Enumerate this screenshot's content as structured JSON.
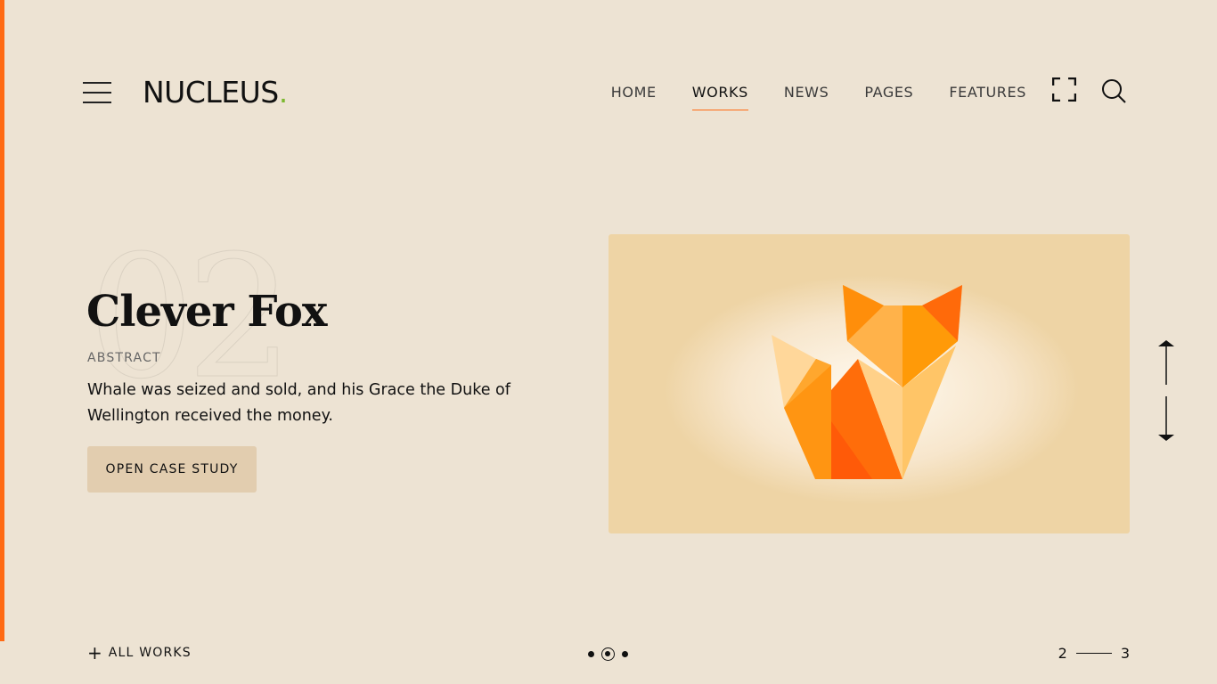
{
  "header": {
    "logo_text": "NUCLEUS",
    "logo_dot": ".",
    "nav": [
      {
        "label": "HOME",
        "active": false
      },
      {
        "label": "WORKS",
        "active": true
      },
      {
        "label": "NEWS",
        "active": false
      },
      {
        "label": "PAGES",
        "active": false
      },
      {
        "label": "FEATURES",
        "active": false
      }
    ],
    "icons": [
      "menu-icon",
      "fullscreen-icon",
      "search-icon"
    ]
  },
  "slide": {
    "number": "02",
    "title": "Clever Fox",
    "category": "ABSTRACT",
    "description": "Whale was seized and sold, and his Grace the Duke of Wellington received the money.",
    "cta_label": "OPEN CASE STUDY",
    "image_subject": "origami fox"
  },
  "footer": {
    "all_works_icon": "+",
    "all_works_label": "ALL WORKS",
    "pager_current": "2",
    "pager_next": "3",
    "dots_count": 3,
    "dots_active_index": 1
  },
  "colors": {
    "background": "#ede3d3",
    "accent": "#ff6a13",
    "logo_dot": "#7cb82f",
    "button_bg": "#e2cdaf",
    "image_bg": "#eed4a5"
  }
}
